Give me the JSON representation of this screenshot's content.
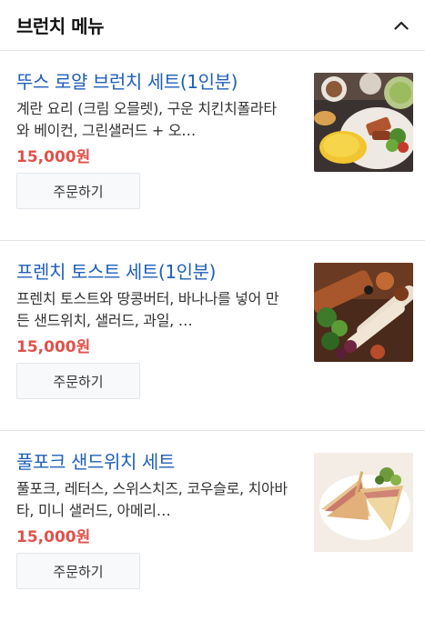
{
  "header": {
    "title": "브런치 메뉴",
    "toggle_icon": "chevron-up-icon"
  },
  "items": [
    {
      "title": "뚜스 로얄 브런치 세트(1인분)",
      "description": "계란 요리 (크림 오믈렛), 구운 치킨치폴라타와 베이컨, 그린샐러드 + 오…",
      "price": "15,000원",
      "order_label": "주문하기",
      "image": "brunch-set-photo"
    },
    {
      "title": "프렌치 토스트 세트(1인분)",
      "description": "프렌치 토스트와 땅콩버터, 바나나를 넣어 만든 샌드위치, 샐러드, 과일, …",
      "price": "15,000원",
      "order_label": "주문하기",
      "image": "french-toast-photo"
    },
    {
      "title": "풀포크 샌드위치 세트",
      "description": "풀포크, 레터스, 스위스치즈, 코우슬로, 치아바타, 미니 샐러드, 아메리…",
      "price": "15,000원",
      "order_label": "주문하기",
      "image": "pulled-pork-sandwich-photo"
    }
  ],
  "colors": {
    "title_link": "#1f5fb8",
    "price": "#e0514b",
    "button_bg": "#f8f9fb"
  }
}
